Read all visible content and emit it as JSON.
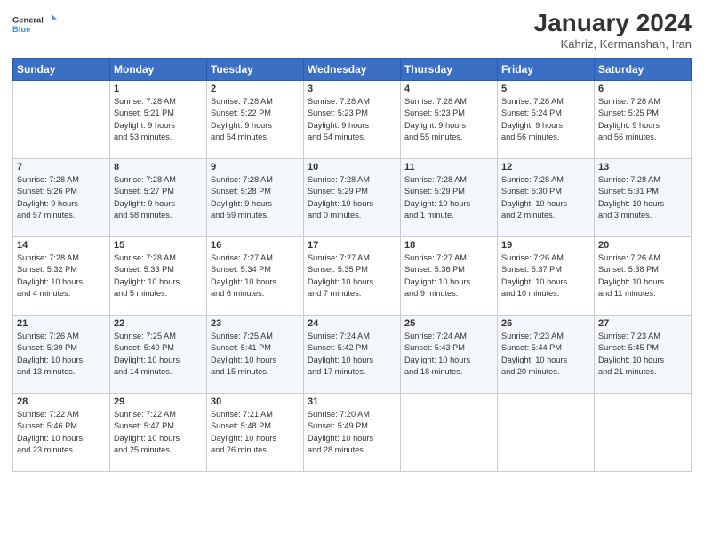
{
  "logo": {
    "line1": "General",
    "line2": "Blue",
    "icon_color": "#4a90d9"
  },
  "title": "January 2024",
  "location": "Kahriz, Kermanshah, Iran",
  "columns": [
    "Sunday",
    "Monday",
    "Tuesday",
    "Wednesday",
    "Thursday",
    "Friday",
    "Saturday"
  ],
  "weeks": [
    [
      {
        "num": "",
        "info": ""
      },
      {
        "num": "1",
        "info": "Sunrise: 7:28 AM\nSunset: 5:21 PM\nDaylight: 9 hours\nand 53 minutes."
      },
      {
        "num": "2",
        "info": "Sunrise: 7:28 AM\nSunset: 5:22 PM\nDaylight: 9 hours\nand 54 minutes."
      },
      {
        "num": "3",
        "info": "Sunrise: 7:28 AM\nSunset: 5:23 PM\nDaylight: 9 hours\nand 54 minutes."
      },
      {
        "num": "4",
        "info": "Sunrise: 7:28 AM\nSunset: 5:23 PM\nDaylight: 9 hours\nand 55 minutes."
      },
      {
        "num": "5",
        "info": "Sunrise: 7:28 AM\nSunset: 5:24 PM\nDaylight: 9 hours\nand 56 minutes."
      },
      {
        "num": "6",
        "info": "Sunrise: 7:28 AM\nSunset: 5:25 PM\nDaylight: 9 hours\nand 56 minutes."
      }
    ],
    [
      {
        "num": "7",
        "info": "Sunrise: 7:28 AM\nSunset: 5:26 PM\nDaylight: 9 hours\nand 57 minutes."
      },
      {
        "num": "8",
        "info": "Sunrise: 7:28 AM\nSunset: 5:27 PM\nDaylight: 9 hours\nand 58 minutes."
      },
      {
        "num": "9",
        "info": "Sunrise: 7:28 AM\nSunset: 5:28 PM\nDaylight: 9 hours\nand 59 minutes."
      },
      {
        "num": "10",
        "info": "Sunrise: 7:28 AM\nSunset: 5:29 PM\nDaylight: 10 hours\nand 0 minutes."
      },
      {
        "num": "11",
        "info": "Sunrise: 7:28 AM\nSunset: 5:29 PM\nDaylight: 10 hours\nand 1 minute."
      },
      {
        "num": "12",
        "info": "Sunrise: 7:28 AM\nSunset: 5:30 PM\nDaylight: 10 hours\nand 2 minutes."
      },
      {
        "num": "13",
        "info": "Sunrise: 7:28 AM\nSunset: 5:31 PM\nDaylight: 10 hours\nand 3 minutes."
      }
    ],
    [
      {
        "num": "14",
        "info": "Sunrise: 7:28 AM\nSunset: 5:32 PM\nDaylight: 10 hours\nand 4 minutes."
      },
      {
        "num": "15",
        "info": "Sunrise: 7:28 AM\nSunset: 5:33 PM\nDaylight: 10 hours\nand 5 minutes."
      },
      {
        "num": "16",
        "info": "Sunrise: 7:27 AM\nSunset: 5:34 PM\nDaylight: 10 hours\nand 6 minutes."
      },
      {
        "num": "17",
        "info": "Sunrise: 7:27 AM\nSunset: 5:35 PM\nDaylight: 10 hours\nand 7 minutes."
      },
      {
        "num": "18",
        "info": "Sunrise: 7:27 AM\nSunset: 5:36 PM\nDaylight: 10 hours\nand 9 minutes."
      },
      {
        "num": "19",
        "info": "Sunrise: 7:26 AM\nSunset: 5:37 PM\nDaylight: 10 hours\nand 10 minutes."
      },
      {
        "num": "20",
        "info": "Sunrise: 7:26 AM\nSunset: 5:38 PM\nDaylight: 10 hours\nand 11 minutes."
      }
    ],
    [
      {
        "num": "21",
        "info": "Sunrise: 7:26 AM\nSunset: 5:39 PM\nDaylight: 10 hours\nand 13 minutes."
      },
      {
        "num": "22",
        "info": "Sunrise: 7:25 AM\nSunset: 5:40 PM\nDaylight: 10 hours\nand 14 minutes."
      },
      {
        "num": "23",
        "info": "Sunrise: 7:25 AM\nSunset: 5:41 PM\nDaylight: 10 hours\nand 15 minutes."
      },
      {
        "num": "24",
        "info": "Sunrise: 7:24 AM\nSunset: 5:42 PM\nDaylight: 10 hours\nand 17 minutes."
      },
      {
        "num": "25",
        "info": "Sunrise: 7:24 AM\nSunset: 5:43 PM\nDaylight: 10 hours\nand 18 minutes."
      },
      {
        "num": "26",
        "info": "Sunrise: 7:23 AM\nSunset: 5:44 PM\nDaylight: 10 hours\nand 20 minutes."
      },
      {
        "num": "27",
        "info": "Sunrise: 7:23 AM\nSunset: 5:45 PM\nDaylight: 10 hours\nand 21 minutes."
      }
    ],
    [
      {
        "num": "28",
        "info": "Sunrise: 7:22 AM\nSunset: 5:46 PM\nDaylight: 10 hours\nand 23 minutes."
      },
      {
        "num": "29",
        "info": "Sunrise: 7:22 AM\nSunset: 5:47 PM\nDaylight: 10 hours\nand 25 minutes."
      },
      {
        "num": "30",
        "info": "Sunrise: 7:21 AM\nSunset: 5:48 PM\nDaylight: 10 hours\nand 26 minutes."
      },
      {
        "num": "31",
        "info": "Sunrise: 7:20 AM\nSunset: 5:49 PM\nDaylight: 10 hours\nand 28 minutes."
      },
      {
        "num": "",
        "info": ""
      },
      {
        "num": "",
        "info": ""
      },
      {
        "num": "",
        "info": ""
      }
    ]
  ]
}
